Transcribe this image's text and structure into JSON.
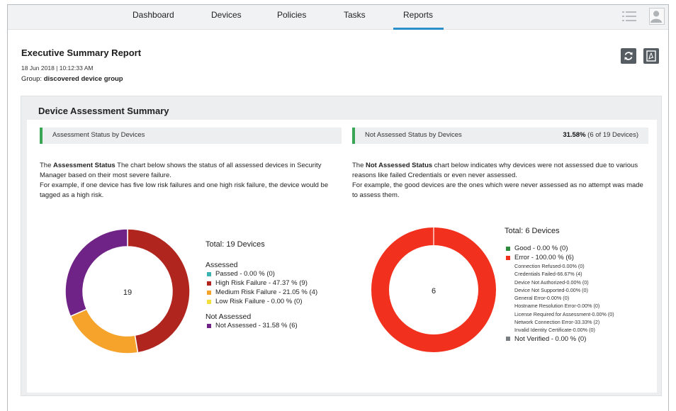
{
  "nav": {
    "tabs": [
      {
        "label": "Dashboard",
        "active": false
      },
      {
        "label": "Devices",
        "active": false
      },
      {
        "label": "Policies",
        "active": false
      },
      {
        "label": "Tasks",
        "active": false
      },
      {
        "label": "Reports",
        "active": true
      }
    ],
    "accent_color": "#2b8fc9"
  },
  "report": {
    "title": "Executive Summary Report",
    "date": "18 Jun 2018 | 10:12:33 AM",
    "group_label": "Group:",
    "group_value": "discovered device group"
  },
  "actions": {
    "refresh_icon": "refresh-icon",
    "pdf_icon": "pdf-export-icon"
  },
  "summary": {
    "title": "Device Assessment Summary"
  },
  "assessment": {
    "heading": "Assessment Status by Devices",
    "desc_bold": "Assessment Status",
    "desc_line1": " The chart below shows the status of all assessed devices in Security Manager based on their most severe failure.",
    "desc_line2": "For example, if one device has five low risk failures and one high risk failure, the device would be tagged as a high risk.",
    "total": "Total: 19 Devices",
    "center_value": "19",
    "assessed_label": "Assessed",
    "not_assessed_label": "Not Assessed"
  },
  "not_assessed": {
    "heading": "Not Assessed Status by Devices",
    "stat_bold": "31.58%",
    "stat_rest": " (6 of 19 Devices)",
    "desc_bold": "Not Assessed Status",
    "desc_line1": " chart below indicates why devices were not assessed due to various reasons like failed Credentials or even never assessed.",
    "desc_line2": "For example, the good devices are the ones which were never assessed as no attempt was made to assess them.",
    "total": "Total: 6 Devices",
    "center_value": "6",
    "sub_reasons": [
      "Connection Refused-0.00% (0)",
      "Credentials Failed-66.67% (4)",
      "Device Not Authorized-0.00% (0)",
      "Device Not Supported-0.00% (0)",
      "General Error-0.00% (0)",
      "Hostname Resolution Error-0.00% (0)",
      "License Required for Assessment-0.00% (0)",
      "Network Connection Error-33.33% (2)",
      "Invalid Identity Certificate-0.00% (0)"
    ]
  },
  "chart_data": [
    {
      "type": "pie",
      "donut": true,
      "total": 19,
      "series": [
        {
          "label": "Passed - 0.00 % (0)",
          "value": 0,
          "color": "#3bb3b3"
        },
        {
          "label": "High Risk Failure - 47.37 % (9)",
          "value": 9,
          "color": "#b0261e"
        },
        {
          "label": "Medium Risk Failure - 21.05 % (4)",
          "value": 4,
          "color": "#f5a32a"
        },
        {
          "label": "Low Risk Failure - 0.00 % (0)",
          "value": 0,
          "color": "#f3de3a"
        },
        {
          "label": "Not Assessed - 31.58 % (6)",
          "value": 6,
          "color": "#6f2386"
        }
      ]
    },
    {
      "type": "pie",
      "donut": true,
      "total": 6,
      "series": [
        {
          "label": "Good - 0.00 % (0)",
          "value": 0,
          "color": "#2e8b3d"
        },
        {
          "label": "Error - 100.00 % (6)",
          "value": 6,
          "color": "#f2301e"
        },
        {
          "label": "Not Verified - 0.00 % (0)",
          "value": 0,
          "color": "#7a7f83"
        }
      ]
    }
  ]
}
